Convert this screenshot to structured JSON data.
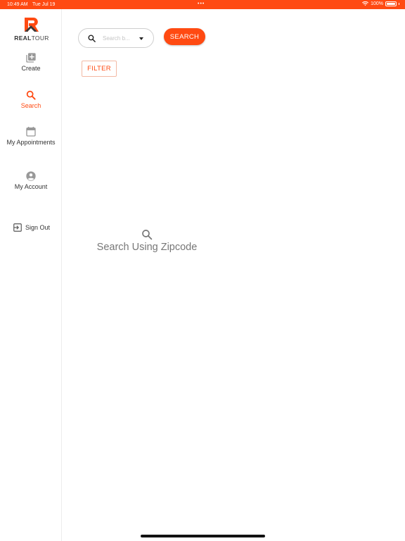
{
  "status_bar": {
    "time": "10:49 AM",
    "date": "Tue Jul 19",
    "dots": "•••",
    "battery": "100%"
  },
  "logo": {
    "brand_bold": "REAL",
    "brand_light": "TOUR"
  },
  "sidebar": {
    "items": [
      {
        "label": "Create",
        "icon": "add-box-icon"
      },
      {
        "label": "Search",
        "icon": "search-icon",
        "active": true
      },
      {
        "label": "My Appointments",
        "icon": "calendar-icon"
      },
      {
        "label": "My Account",
        "icon": "account-circle-icon"
      }
    ],
    "signout_label": "Sign Out"
  },
  "search": {
    "placeholder": "Search b...",
    "value": "",
    "button_label": "SEARCH"
  },
  "filter": {
    "label": "FILTER"
  },
  "empty_state": {
    "message": "Search Using Zipcode"
  },
  "colors": {
    "accent": "#ff4a12",
    "text": "#333333",
    "muted": "#777777"
  }
}
